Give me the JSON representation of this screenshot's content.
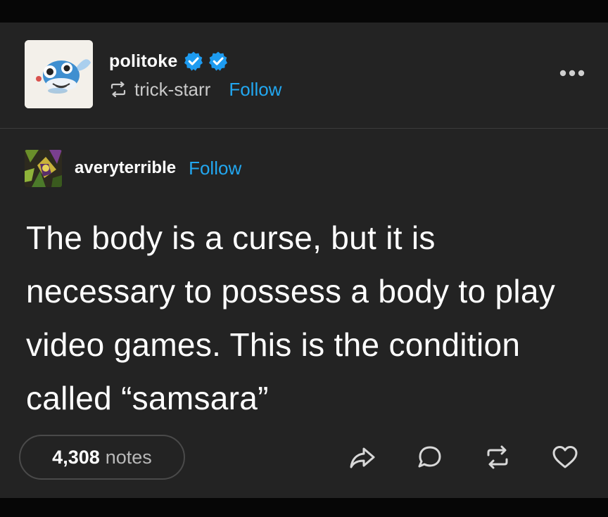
{
  "post": {
    "blog_name": "politoke",
    "badges": [
      "verified-badge-icon",
      "verified-badge-icon"
    ],
    "reblogged_from": "trick-starr",
    "follow_label": "Follow",
    "menu_icon": "more-horizontal-icon"
  },
  "trail": {
    "blog_name": "averyterrible",
    "follow_label": "Follow",
    "text": "The body is a curse, but it is necessary to possess a body to play video games. This is the condition called “samsara”"
  },
  "footer": {
    "notes_count": "4,308",
    "notes_label": "notes",
    "actions": [
      "share-icon",
      "reply-icon",
      "reblog-icon",
      "like-icon"
    ]
  },
  "colors": {
    "background": "#060606",
    "card": "#232323",
    "link": "#22a7f0",
    "badge": "#1d9bf0",
    "text": "#ffffff"
  }
}
